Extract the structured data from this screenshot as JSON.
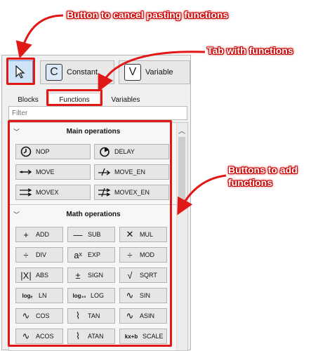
{
  "annotations": {
    "cancel": "Button to cancel pasting functions",
    "tab": "Tab with functions",
    "add_line1": "Buttons to add",
    "add_line2": "functions"
  },
  "toolbar": {
    "pointer_icon": "cursor-arrow-icon",
    "constant_letter": "C",
    "constant_label": "Constant",
    "variable_letter": "V",
    "variable_label": "Variable"
  },
  "tabs": [
    {
      "label": "Blocks"
    },
    {
      "label": "Functions",
      "selected": true
    },
    {
      "label": "Variables"
    }
  ],
  "filter": {
    "placeholder": "Filter",
    "value": ""
  },
  "sections": [
    {
      "title": "Main operations",
      "buttons": [
        {
          "label": "NOP",
          "icon": "clock-icon"
        },
        {
          "label": "DELAY",
          "icon": "timer-icon"
        },
        {
          "label": "MOVE",
          "icon": "move-arrow-icon"
        },
        {
          "label": "MOVE_EN",
          "icon": "move-enable-icon"
        },
        {
          "label": "MOVEX",
          "icon": "movex-icon"
        },
        {
          "label": "MOVEX_EN",
          "icon": "movex-enable-icon"
        }
      ]
    },
    {
      "title": "Math operations",
      "buttons": [
        {
          "label": "ADD",
          "icon": "plus-icon",
          "glyph": "+"
        },
        {
          "label": "SUB",
          "icon": "minus-icon",
          "glyph": "—"
        },
        {
          "label": "MUL",
          "icon": "multiply-icon",
          "glyph": "✕"
        },
        {
          "label": "DIV",
          "icon": "divide-icon",
          "glyph": "÷"
        },
        {
          "label": "EXP",
          "icon": "exponent-icon",
          "glyph": "aˣ"
        },
        {
          "label": "MOD",
          "icon": "modulo-icon",
          "glyph": "÷"
        },
        {
          "label": "ABS",
          "icon": "absolute-icon",
          "glyph": "|X|"
        },
        {
          "label": "SIGN",
          "icon": "plus-minus-icon",
          "glyph": "±"
        },
        {
          "label": "SQRT",
          "icon": "square-root-icon",
          "glyph": "√"
        },
        {
          "label": "LN",
          "icon": "natural-log-icon",
          "glyph": "logₑ"
        },
        {
          "label": "LOG",
          "icon": "log10-icon",
          "glyph": "log₁₀"
        },
        {
          "label": "SIN",
          "icon": "sine-icon",
          "glyph": "∿"
        },
        {
          "label": "COS",
          "icon": "cosine-icon",
          "glyph": "∿"
        },
        {
          "label": "TAN",
          "icon": "tangent-icon",
          "glyph": "⌇"
        },
        {
          "label": "ASIN",
          "icon": "arcsine-icon",
          "glyph": "∿"
        },
        {
          "label": "ACOS",
          "icon": "arccosine-icon",
          "glyph": "∿"
        },
        {
          "label": "ATAN",
          "icon": "arctangent-icon",
          "glyph": "⌇"
        },
        {
          "label": "SCALE",
          "icon": "scale-icon",
          "glyph": "kx+b"
        }
      ]
    }
  ],
  "colors": {
    "highlight": "#e11818",
    "selected_button": "#cfe4f7"
  }
}
